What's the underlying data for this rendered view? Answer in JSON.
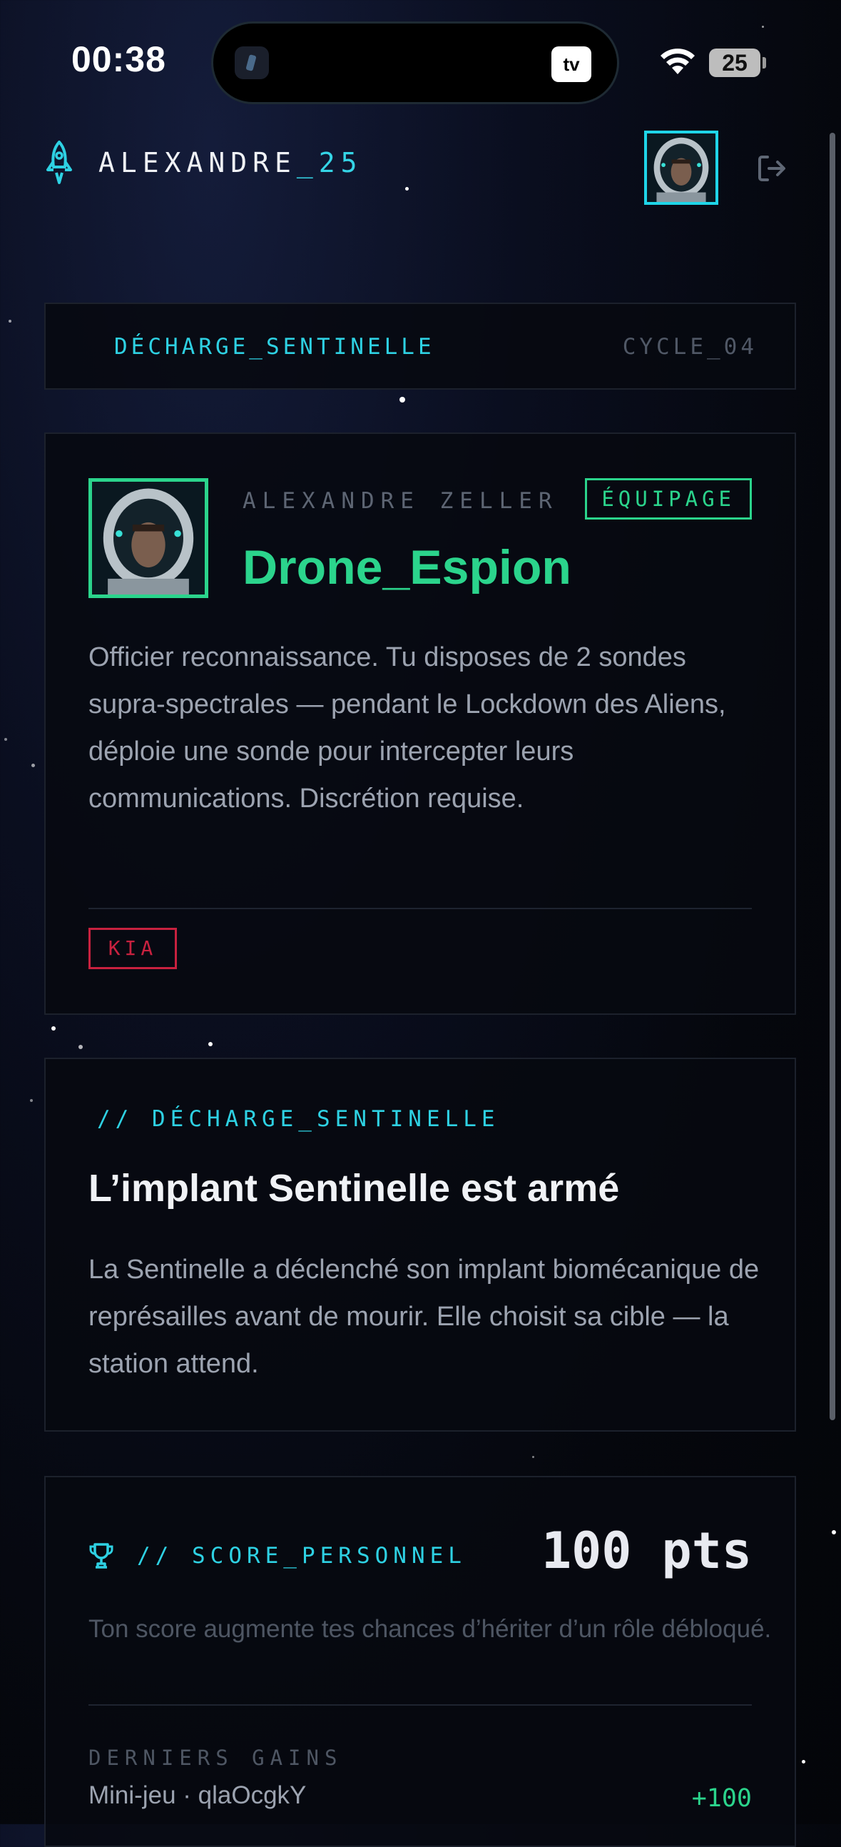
{
  "status_bar": {
    "time": "00:38",
    "tv_label": "tv",
    "battery": "25"
  },
  "header": {
    "username_prefix": "ALEXANDRE",
    "username_suffix": "_25"
  },
  "round": {
    "title": "DÉCHARGE_SENTINELLE",
    "cycle": "CYCLE_04"
  },
  "role_card": {
    "player_name": "ALEXANDRE ZELLER",
    "team": "ÉQUIPAGE",
    "role": "Drone_Espion",
    "description": "Officier reconnaissance. Tu disposes de 2 sondes supra-spectrales — pendant le Lockdown des Aliens, déploie une sonde pour intercepter leurs communications. Discrétion requise.",
    "status": "KIA"
  },
  "event_card": {
    "tag": "// DÉCHARGE_SENTINELLE",
    "title": "L’implant Sentinelle est armé",
    "description": "La Sentinelle a déclenché son implant biomécanique de représailles avant de mourir. Elle choisit sa cible — la station attend."
  },
  "score_card": {
    "tag": "// SCORE_PERSONNEL",
    "value": "100 pts",
    "hint": "Ton score augmente tes chances d’hériter d’un rôle débloqué.",
    "gains_label": "DERNIERS GAINS",
    "gains": [
      {
        "source": "Mini-jeu · qlaOcgkY",
        "points": "+100"
      }
    ]
  },
  "colors": {
    "accent_cyan": "#2ed1e3",
    "accent_green": "#2bd48c",
    "danger_red": "#c8213f",
    "background": "#05070d"
  },
  "icons": {
    "rocket": "rocket-icon",
    "logout": "logout-icon",
    "trophy": "trophy-icon",
    "wifi": "wifi-icon",
    "battery": "battery-icon"
  }
}
